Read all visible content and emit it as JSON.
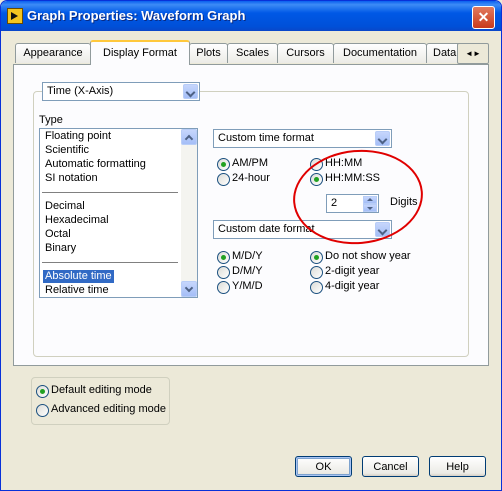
{
  "window": {
    "title": "Graph Properties: Waveform Graph",
    "close_label": "✕"
  },
  "tabs": [
    {
      "label": "Appearance"
    },
    {
      "label": "Display Format"
    },
    {
      "label": "Plots"
    },
    {
      "label": "Scales"
    },
    {
      "label": "Cursors"
    },
    {
      "label": "Documentation"
    },
    {
      "label": "Data"
    }
  ],
  "tab_scroll": {
    "left": "◄",
    "right": "►"
  },
  "axis_select": {
    "value": "Time (X-Axis)"
  },
  "type_list": {
    "label": "Type",
    "groups": [
      [
        "Floating point",
        "Scientific",
        "Automatic formatting",
        "SI notation"
      ],
      [
        "Decimal",
        "Hexadecimal",
        "Octal",
        "Binary"
      ],
      [
        "Absolute time",
        "Relative time"
      ]
    ],
    "selected": "Absolute time"
  },
  "time_format": {
    "select_value": "Custom time format",
    "options": [
      {
        "label": "AM/PM",
        "checked": true
      },
      {
        "label": "24-hour",
        "checked": false
      },
      {
        "label": "HH:MM",
        "checked": false
      },
      {
        "label": "HH:MM:SS",
        "checked": true
      }
    ],
    "digits_value": "2",
    "digits_label": "Digits"
  },
  "date_format": {
    "select_value": "Custom date format",
    "order_options": [
      {
        "label": "M/D/Y",
        "checked": true
      },
      {
        "label": "D/M/Y",
        "checked": false
      },
      {
        "label": "Y/M/D",
        "checked": false
      }
    ],
    "year_options": [
      {
        "label": "Do not show year",
        "checked": true
      },
      {
        "label": "2-digit year",
        "checked": false
      },
      {
        "label": "4-digit year",
        "checked": false
      }
    ]
  },
  "editing_mode": [
    {
      "label": "Default editing mode",
      "checked": true
    },
    {
      "label": "Advanced editing mode",
      "checked": false
    }
  ],
  "buttons": {
    "ok": "OK",
    "cancel": "Cancel",
    "help": "Help"
  },
  "colors": {
    "title_bar": "#0058E6",
    "annotation_circle": "#E00000",
    "selection": "#316AC5"
  }
}
